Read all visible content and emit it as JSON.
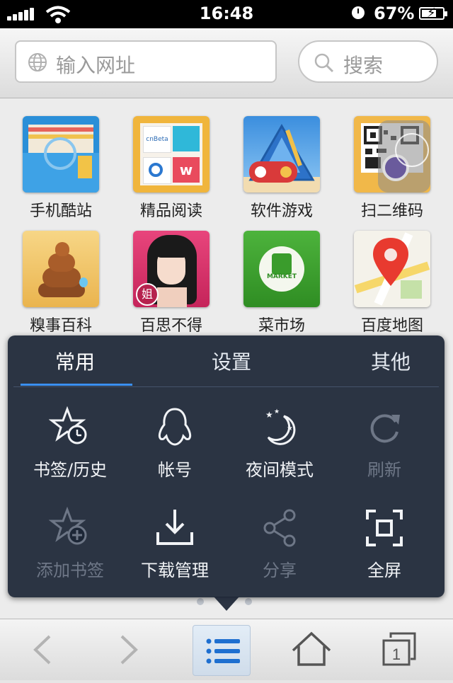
{
  "status": {
    "time": "16:48",
    "battery": "67%"
  },
  "address_bar": {
    "url_placeholder": "输入网址",
    "search_placeholder": "搜索"
  },
  "apps": [
    {
      "label": "手机酷站",
      "icon": "bookmark-globe-icon"
    },
    {
      "label": "精品阅读",
      "icon": "reading-shelf-icon",
      "tiles": [
        "cnBeta"
      ]
    },
    {
      "label": "软件游戏",
      "icon": "gamepad-triangle-icon"
    },
    {
      "label": "扫二维码",
      "icon": "qr-code-icon"
    },
    {
      "label": "糗事百科",
      "icon": "poop-icon"
    },
    {
      "label": "百思不得",
      "icon": "anime-girl-icon",
      "badge": "姐"
    },
    {
      "label": "菜市场",
      "icon": "vegetable-market-icon",
      "badge": "MARKET"
    },
    {
      "label": "百度地图",
      "icon": "map-pin-icon"
    }
  ],
  "menu": {
    "tabs": [
      "常用",
      "设置",
      "其他"
    ],
    "active_tab": "常用",
    "items": [
      {
        "label": "书签/历史",
        "icon": "star-clock-icon",
        "enabled": true
      },
      {
        "label": "帐号",
        "icon": "qq-penguin-icon",
        "enabled": true
      },
      {
        "label": "夜间模式",
        "icon": "moon-stars-icon",
        "enabled": true
      },
      {
        "label": "刷新",
        "icon": "refresh-icon",
        "enabled": false
      },
      {
        "label": "添加书签",
        "icon": "star-plus-icon",
        "enabled": false
      },
      {
        "label": "下载管理",
        "icon": "download-icon",
        "enabled": true
      },
      {
        "label": "分享",
        "icon": "share-icon",
        "enabled": false
      },
      {
        "label": "全屏",
        "icon": "fullscreen-icon",
        "enabled": true
      }
    ]
  },
  "toolbar": {
    "buttons": [
      "back-icon",
      "forward-icon",
      "menu-list-icon",
      "home-icon",
      "windows-icon"
    ],
    "window_count": "1"
  },
  "colors": {
    "accent": "#3a8ff0",
    "menu_bg": "#1c2636"
  }
}
